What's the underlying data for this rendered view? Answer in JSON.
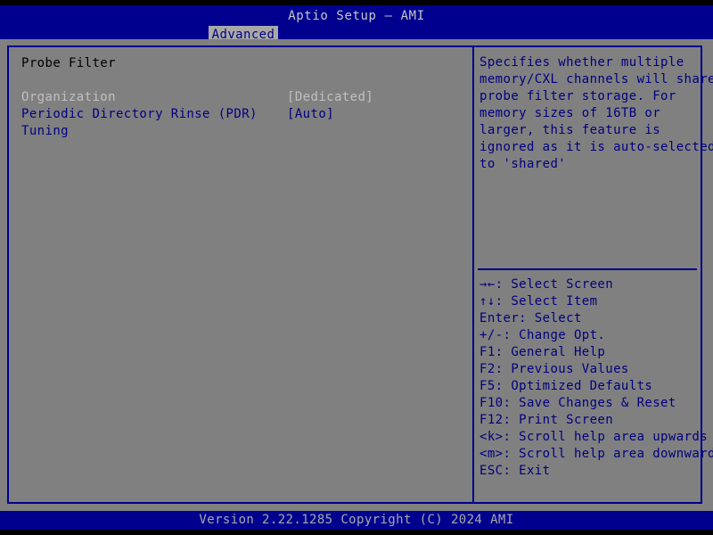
{
  "header": {
    "title": "Aptio Setup – AMI",
    "tabs": [
      {
        "label": "Advanced",
        "active": true
      }
    ]
  },
  "main": {
    "section_title": "Probe Filter",
    "options": [
      {
        "label": "Organization",
        "value": "[Dedicated]",
        "state": "disabled",
        "selected": false
      },
      {
        "label": "Periodic Directory Rinse (PDR)",
        "value": "[Auto]",
        "state": "enabled",
        "selected": false
      },
      {
        "label": "Tuning",
        "value": "",
        "state": "enabled",
        "selected": false
      }
    ]
  },
  "help": {
    "lines": [
      "Specifies whether multiple",
      "memory/CXL channels will share",
      "probe filter storage. For",
      "memory sizes of 16TB or",
      "larger, this feature is",
      "ignored as it is auto-selected",
      "to 'shared'"
    ]
  },
  "keys": {
    "items": [
      "→←: Select Screen",
      "↑↓: Select Item",
      "Enter: Select",
      "+/-: Change Opt.",
      "F1: General Help",
      "F2: Previous Values",
      "F5: Optimized Defaults",
      "F10: Save Changes & Reset",
      "F12: Print Screen",
      "<k>: Scroll help area upwards",
      "<m>: Scroll help area downwards",
      "ESC: Exit"
    ]
  },
  "footer": {
    "version_text": "Version 2.22.1285 Copyright (C) 2024 AMI"
  },
  "colors": {
    "header_blue": "#00008f",
    "body_gray": "#808080",
    "text_blue": "#00007f",
    "text_disabled": "#c0c0c0",
    "tab_bg": "#a8a8a8",
    "footer_text": "#a8a8a8"
  }
}
